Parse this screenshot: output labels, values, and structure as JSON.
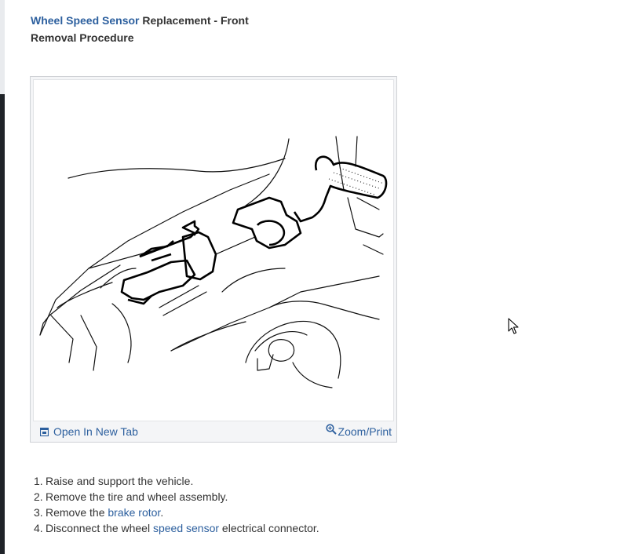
{
  "header": {
    "title_link": "Wheel Speed Sensor",
    "title_rest": "Replacement - Front",
    "subtitle": "Removal Procedure"
  },
  "figure": {
    "open_tab_label": "Open In New Tab",
    "zoom_label": "Zoom/Print",
    "open_tab_icon": "open-in-new-tab-icon",
    "zoom_icon": "magnifier-plus-icon"
  },
  "steps": [
    {
      "num": "1.",
      "pre": "Raise and support the vehicle.",
      "link": "",
      "post": ""
    },
    {
      "num": "2.",
      "pre": "Remove the tire and wheel assembly.",
      "link": "",
      "post": ""
    },
    {
      "num": "3.",
      "pre": "Remove the ",
      "link": "brake rotor",
      "post": "."
    },
    {
      "num": "4.",
      "pre": "Disconnect the wheel ",
      "link": "speed sensor",
      "post": " electrical connector."
    }
  ],
  "colors": {
    "link": "#2c5f9e",
    "text": "#333333",
    "frame": "#cfd2d6"
  }
}
